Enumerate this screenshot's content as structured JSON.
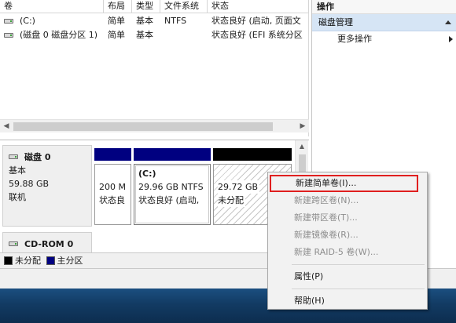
{
  "volume_list": {
    "columns": [
      "卷",
      "布局",
      "类型",
      "文件系统",
      "状态"
    ],
    "rows": [
      {
        "volume": "(C:)",
        "layout": "简单",
        "type": "基本",
        "fs": "NTFS",
        "status": "状态良好 (启动, 页面文"
      },
      {
        "volume": "(磁盘 0 磁盘分区 1)",
        "layout": "简单",
        "type": "基本",
        "fs": "",
        "status": "状态良好 (EFI 系统分区"
      }
    ]
  },
  "disk0": {
    "title": "磁盘 0",
    "type": "基本",
    "size": "59.88 GB",
    "status": "联机",
    "partitions": [
      {
        "size": "200 M",
        "status": "状态良",
        "bar_color": "#000080"
      },
      {
        "name": "(C:)",
        "size": "29.96 GB NTFS",
        "status": "状态良好 (启动,",
        "bar_color": "#000080"
      },
      {
        "size": "29.72 GB",
        "status": "未分配",
        "bar_color": "#000000"
      }
    ]
  },
  "cdrom0": {
    "title": "CD-ROM 0"
  },
  "legend": {
    "unallocated": "未分配",
    "primary": "主分区",
    "unallocated_color": "#000000",
    "primary_color": "#000080"
  },
  "actions": {
    "header": "操作",
    "section": "磁盘管理",
    "more": "更多操作"
  },
  "context_menu": {
    "items": [
      {
        "label": "新建简单卷(I)...",
        "enabled": true,
        "highlighted": true
      },
      {
        "label": "新建跨区卷(N)...",
        "enabled": false
      },
      {
        "label": "新建带区卷(T)...",
        "enabled": false
      },
      {
        "label": "新建镜像卷(R)...",
        "enabled": false
      },
      {
        "label": "新建 RAID-5 卷(W)...",
        "enabled": false
      }
    ],
    "properties": "属性(P)",
    "help": "帮助(H)"
  },
  "colors": {
    "selection_highlight": "#d6e5f5",
    "annotation_box": "#e01f1f",
    "taskbar": "#123b63"
  }
}
